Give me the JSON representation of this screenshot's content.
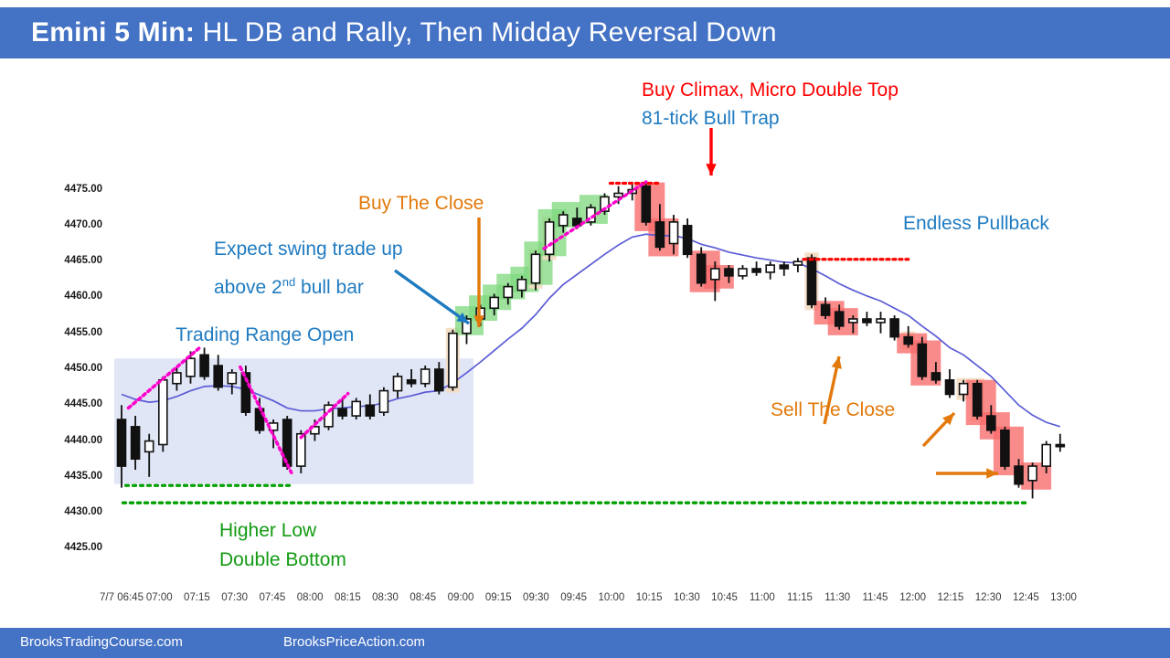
{
  "header": {
    "title_bold": "Emini 5 Min:",
    "title_rest": " HL DB and Rally, Then Midday Reversal Down",
    "bg_color": "#4472C4"
  },
  "footer": {
    "link_left": "BrooksTradingCourse.com",
    "link_right": "BrooksPriceAction.com",
    "bg_color": "#4472C4"
  },
  "annotations": {
    "buy_climax": "Buy Climax, Micro Double Top",
    "bull_trap": "81-tick Bull Trap",
    "buy_the_close": "Buy The Close",
    "expect_swing_line1": "Expect swing trade up",
    "expect_swing_line2a": "above 2",
    "expect_swing_sup": "nd",
    "expect_swing_line2b": " bull bar",
    "trading_range_open": "Trading Range Open",
    "endless_pullback": "Endless Pullback",
    "sell_the_close": "Sell The Close",
    "higher_low": "Higher Low",
    "double_bottom": "Double Bottom"
  },
  "colors": {
    "annotation_blue": "#1F7BC1",
    "annotation_red": "#FF0000",
    "annotation_orange": "#E2790B",
    "annotation_green": "#139B13",
    "ema_line": "#5B5BD6",
    "trendline_magenta": "#FF00CC",
    "support_green": "#00A000",
    "resistance_red": "#FF0000",
    "bull_highlight": "#7DD87D",
    "bear_highlight": "#F96A6A",
    "signal_bar_highlight": "#F2DCC4",
    "range_box_fill": "#DDE3F5"
  },
  "chart_data": {
    "type": "candlestick",
    "title": "Emini 5 Min: HL DB and Rally, Then Midday Reversal Down",
    "xlabel": "",
    "ylabel": "",
    "ylim": [
      4422.0,
      4478.0
    ],
    "yticks": [
      "4475.00",
      "4470.00",
      "4465.00",
      "4460.00",
      "4455.00",
      "4450.00",
      "4445.00",
      "4440.00",
      "4435.00",
      "4430.00",
      "4425.00"
    ],
    "ytick_values": [
      4475,
      4470,
      4465,
      4460,
      4455,
      4450,
      4445,
      4440,
      4435,
      4430,
      4425
    ],
    "xticks": [
      "7/7 06:45",
      "07:00",
      "07:15",
      "07:30",
      "07:45",
      "08:00",
      "08:15",
      "08:30",
      "08:45",
      "09:00",
      "09:15",
      "09:30",
      "09:45",
      "10:00",
      "10:15",
      "10:30",
      "10:45",
      "11:00",
      "11:15",
      "11:30",
      "11:45",
      "12:00",
      "12:15",
      "12:30",
      "12:45",
      "13:00"
    ],
    "grid": false,
    "legend": "none",
    "bars": [
      {
        "i": 0,
        "o": 4443.0,
        "h": 4445.0,
        "l": 4433.5,
        "c": 4436.5,
        "dir": "down"
      },
      {
        "i": 1,
        "o": 4442.0,
        "h": 4443.5,
        "l": 4436.0,
        "c": 4437.5,
        "dir": "down"
      },
      {
        "i": 2,
        "o": 4438.5,
        "h": 4441.0,
        "l": 4435.0,
        "c": 4440.0,
        "dir": "up"
      },
      {
        "i": 3,
        "o": 4439.5,
        "h": 4449.0,
        "l": 4438.5,
        "c": 4448.5,
        "dir": "up"
      },
      {
        "i": 4,
        "o": 4448.0,
        "h": 4450.5,
        "l": 4447.0,
        "c": 4449.5,
        "dir": "up"
      },
      {
        "i": 5,
        "o": 4449.0,
        "h": 4452.5,
        "l": 4448.0,
        "c": 4451.5,
        "dir": "up"
      },
      {
        "i": 6,
        "o": 4452.0,
        "h": 4453.0,
        "l": 4448.5,
        "c": 4449.0,
        "dir": "down"
      },
      {
        "i": 7,
        "o": 4450.5,
        "h": 4452.0,
        "l": 4447.0,
        "c": 4447.5,
        "dir": "down"
      },
      {
        "i": 8,
        "o": 4448.0,
        "h": 4450.0,
        "l": 4446.5,
        "c": 4449.5,
        "dir": "up"
      },
      {
        "i": 9,
        "o": 4449.5,
        "h": 4450.5,
        "l": 4443.5,
        "c": 4444.0,
        "dir": "down"
      },
      {
        "i": 10,
        "o": 4444.5,
        "h": 4446.0,
        "l": 4441.0,
        "c": 4441.5,
        "dir": "down"
      },
      {
        "i": 11,
        "o": 4441.5,
        "h": 4443.0,
        "l": 4439.0,
        "c": 4442.5,
        "dir": "up"
      },
      {
        "i": 12,
        "o": 4443.0,
        "h": 4443.5,
        "l": 4436.0,
        "c": 4436.5,
        "dir": "down"
      },
      {
        "i": 13,
        "o": 4436.5,
        "h": 4441.5,
        "l": 4435.5,
        "c": 4441.0,
        "dir": "up"
      },
      {
        "i": 14,
        "o": 4441.0,
        "h": 4443.0,
        "l": 4440.0,
        "c": 4442.0,
        "dir": "up"
      },
      {
        "i": 15,
        "o": 4442.0,
        "h": 4445.5,
        "l": 4441.5,
        "c": 4445.0,
        "dir": "up"
      },
      {
        "i": 16,
        "o": 4444.5,
        "h": 4446.0,
        "l": 4443.0,
        "c": 4443.5,
        "dir": "down"
      },
      {
        "i": 17,
        "o": 4443.5,
        "h": 4446.0,
        "l": 4443.0,
        "c": 4445.5,
        "dir": "up"
      },
      {
        "i": 18,
        "o": 4445.0,
        "h": 4446.5,
        "l": 4443.0,
        "c": 4443.5,
        "dir": "down"
      },
      {
        "i": 19,
        "o": 4444.0,
        "h": 4447.5,
        "l": 4443.5,
        "c": 4447.0,
        "dir": "up"
      },
      {
        "i": 20,
        "o": 4447.0,
        "h": 4449.5,
        "l": 4446.0,
        "c": 4449.0,
        "dir": "up"
      },
      {
        "i": 21,
        "o": 4448.5,
        "h": 4450.0,
        "l": 4447.5,
        "c": 4448.0,
        "dir": "down"
      },
      {
        "i": 22,
        "o": 4448.0,
        "h": 4450.5,
        "l": 4447.5,
        "c": 4450.0,
        "dir": "up"
      },
      {
        "i": 23,
        "o": 4450.0,
        "h": 4451.0,
        "l": 4446.5,
        "c": 4447.0,
        "dir": "down"
      },
      {
        "i": 24,
        "o": 4447.5,
        "h": 4455.5,
        "l": 4447.0,
        "c": 4455.0,
        "dir": "up",
        "signal": true
      },
      {
        "i": 25,
        "o": 4455.0,
        "h": 4457.5,
        "l": 4453.5,
        "c": 4457.0,
        "dir": "up",
        "bull": true
      },
      {
        "i": 26,
        "o": 4457.0,
        "h": 4459.0,
        "l": 4456.0,
        "c": 4458.5,
        "dir": "up",
        "bull": true
      },
      {
        "i": 27,
        "o": 4458.5,
        "h": 4460.5,
        "l": 4457.5,
        "c": 4460.0,
        "dir": "up",
        "bull": true
      },
      {
        "i": 28,
        "o": 4460.0,
        "h": 4462.0,
        "l": 4459.0,
        "c": 4461.5,
        "dir": "up",
        "bull": true
      },
      {
        "i": 29,
        "o": 4461.0,
        "h": 4463.0,
        "l": 4460.0,
        "c": 4462.5,
        "dir": "up",
        "bull": true
      },
      {
        "i": 30,
        "o": 4462.0,
        "h": 4466.5,
        "l": 4461.0,
        "c": 4466.0,
        "dir": "up",
        "bull": true,
        "signal": true
      },
      {
        "i": 31,
        "o": 4466.0,
        "h": 4471.0,
        "l": 4465.0,
        "c": 4470.5,
        "dir": "up",
        "bull": true,
        "signal": true
      },
      {
        "i": 32,
        "o": 4470.0,
        "h": 4472.0,
        "l": 4469.0,
        "c": 4471.5,
        "dir": "up",
        "bull": true
      },
      {
        "i": 33,
        "o": 4471.0,
        "h": 4472.5,
        "l": 4469.5,
        "c": 4470.0,
        "dir": "down"
      },
      {
        "i": 34,
        "o": 4470.5,
        "h": 4473.0,
        "l": 4470.0,
        "c": 4472.5,
        "dir": "up",
        "bull": true
      },
      {
        "i": 35,
        "o": 4472.0,
        "h": 4474.5,
        "l": 4471.5,
        "c": 4474.0,
        "dir": "up"
      },
      {
        "i": 36,
        "o": 4474.0,
        "h": 4475.5,
        "l": 4473.0,
        "c": 4474.5,
        "dir": "up"
      },
      {
        "i": 37,
        "o": 4474.5,
        "h": 4476.0,
        "l": 4473.5,
        "c": 4475.0,
        "dir": "up"
      },
      {
        "i": 38,
        "o": 4475.5,
        "h": 4476.0,
        "l": 4470.0,
        "c": 4470.5,
        "dir": "down",
        "bear": true
      },
      {
        "i": 39,
        "o": 4470.5,
        "h": 4473.0,
        "l": 4466.5,
        "c": 4467.0,
        "dir": "down",
        "bear": true
      },
      {
        "i": 40,
        "o": 4467.5,
        "h": 4471.5,
        "l": 4466.0,
        "c": 4470.5,
        "dir": "up"
      },
      {
        "i": 41,
        "o": 4470.0,
        "h": 4471.0,
        "l": 4465.5,
        "c": 4466.0,
        "dir": "down"
      },
      {
        "i": 42,
        "o": 4466.0,
        "h": 4467.0,
        "l": 4461.5,
        "c": 4462.0,
        "dir": "down",
        "bear": true
      },
      {
        "i": 43,
        "o": 4462.5,
        "h": 4465.0,
        "l": 4459.5,
        "c": 4464.0,
        "dir": "up",
        "bear": true
      },
      {
        "i": 44,
        "o": 4464.0,
        "h": 4464.5,
        "l": 4462.0,
        "c": 4463.0,
        "dir": "down"
      },
      {
        "i": 45,
        "o": 4463.0,
        "h": 4464.5,
        "l": 4462.5,
        "c": 4464.0,
        "dir": "up"
      },
      {
        "i": 46,
        "o": 4464.0,
        "h": 4465.0,
        "l": 4463.0,
        "c": 4463.5,
        "dir": "down"
      },
      {
        "i": 47,
        "o": 4463.5,
        "h": 4465.0,
        "l": 4462.5,
        "c": 4464.5,
        "dir": "up"
      },
      {
        "i": 48,
        "o": 4464.5,
        "h": 4465.0,
        "l": 4463.0,
        "c": 4464.0,
        "dir": "down"
      },
      {
        "i": 49,
        "o": 4464.5,
        "h": 4465.5,
        "l": 4463.5,
        "c": 4465.0,
        "dir": "up"
      },
      {
        "i": 50,
        "o": 4465.5,
        "h": 4466.0,
        "l": 4458.5,
        "c": 4459.0,
        "dir": "down",
        "signal": true
      },
      {
        "i": 51,
        "o": 4459.0,
        "h": 4460.0,
        "l": 4457.0,
        "c": 4457.5,
        "dir": "down",
        "bear": true
      },
      {
        "i": 52,
        "o": 4458.0,
        "h": 4459.0,
        "l": 4455.5,
        "c": 4456.0,
        "dir": "down",
        "bear": true
      },
      {
        "i": 53,
        "o": 4456.5,
        "h": 4457.5,
        "l": 4455.0,
        "c": 4457.0,
        "dir": "up"
      },
      {
        "i": 54,
        "o": 4457.0,
        "h": 4458.0,
        "l": 4456.0,
        "c": 4456.5,
        "dir": "down"
      },
      {
        "i": 55,
        "o": 4456.5,
        "h": 4458.0,
        "l": 4455.0,
        "c": 4457.0,
        "dir": "up"
      },
      {
        "i": 56,
        "o": 4457.0,
        "h": 4457.5,
        "l": 4454.0,
        "c": 4454.5,
        "dir": "down"
      },
      {
        "i": 57,
        "o": 4454.5,
        "h": 4456.0,
        "l": 4453.0,
        "c": 4453.5,
        "dir": "down",
        "bear": true,
        "signal": true
      },
      {
        "i": 58,
        "o": 4453.5,
        "h": 4454.5,
        "l": 4448.5,
        "c": 4449.0,
        "dir": "down",
        "bear": true
      },
      {
        "i": 59,
        "o": 4449.5,
        "h": 4451.0,
        "l": 4448.0,
        "c": 4448.5,
        "dir": "down"
      },
      {
        "i": 60,
        "o": 4448.5,
        "h": 4450.0,
        "l": 4446.0,
        "c": 4446.5,
        "dir": "down"
      },
      {
        "i": 61,
        "o": 4446.5,
        "h": 4448.5,
        "l": 4445.5,
        "c": 4448.0,
        "dir": "up",
        "signal": true
      },
      {
        "i": 62,
        "o": 4448.0,
        "h": 4448.5,
        "l": 4443.0,
        "c": 4443.5,
        "dir": "down",
        "bear": true,
        "signal": true
      },
      {
        "i": 63,
        "o": 4443.5,
        "h": 4445.0,
        "l": 4441.0,
        "c": 4441.5,
        "dir": "down",
        "bear": true
      },
      {
        "i": 64,
        "o": 4441.5,
        "h": 4442.0,
        "l": 4436.0,
        "c": 4436.5,
        "dir": "down",
        "bear": true
      },
      {
        "i": 65,
        "o": 4436.5,
        "h": 4437.5,
        "l": 4433.5,
        "c": 4434.0,
        "dir": "down"
      },
      {
        "i": 66,
        "o": 4434.5,
        "h": 4437.0,
        "l": 4432.0,
        "c": 4436.5,
        "dir": "up",
        "bear": true
      },
      {
        "i": 67,
        "o": 4436.5,
        "h": 4440.0,
        "l": 4435.5,
        "c": 4439.5,
        "dir": "up"
      },
      {
        "i": 68,
        "o": 4439.5,
        "h": 4441.0,
        "l": 4438.5,
        "c": 4439.5,
        "dir": "down"
      }
    ],
    "ema": {
      "name": "EMA",
      "color": "#5B5BD6"
    },
    "overlays": {
      "trading_range_box": {
        "label": "Trading Range Open"
      },
      "support_lines": [
        {
          "name": "higher-low-line"
        },
        {
          "name": "double-bottom-line"
        }
      ],
      "resistance_lines": [
        {
          "name": "micro-double-top-line"
        },
        {
          "name": "lower-high-line"
        }
      ],
      "trendlines": [
        {
          "name": "bull-trendline-open"
        },
        {
          "name": "bear-trendline-open"
        },
        {
          "name": "bull-trendline-rally"
        }
      ]
    }
  }
}
